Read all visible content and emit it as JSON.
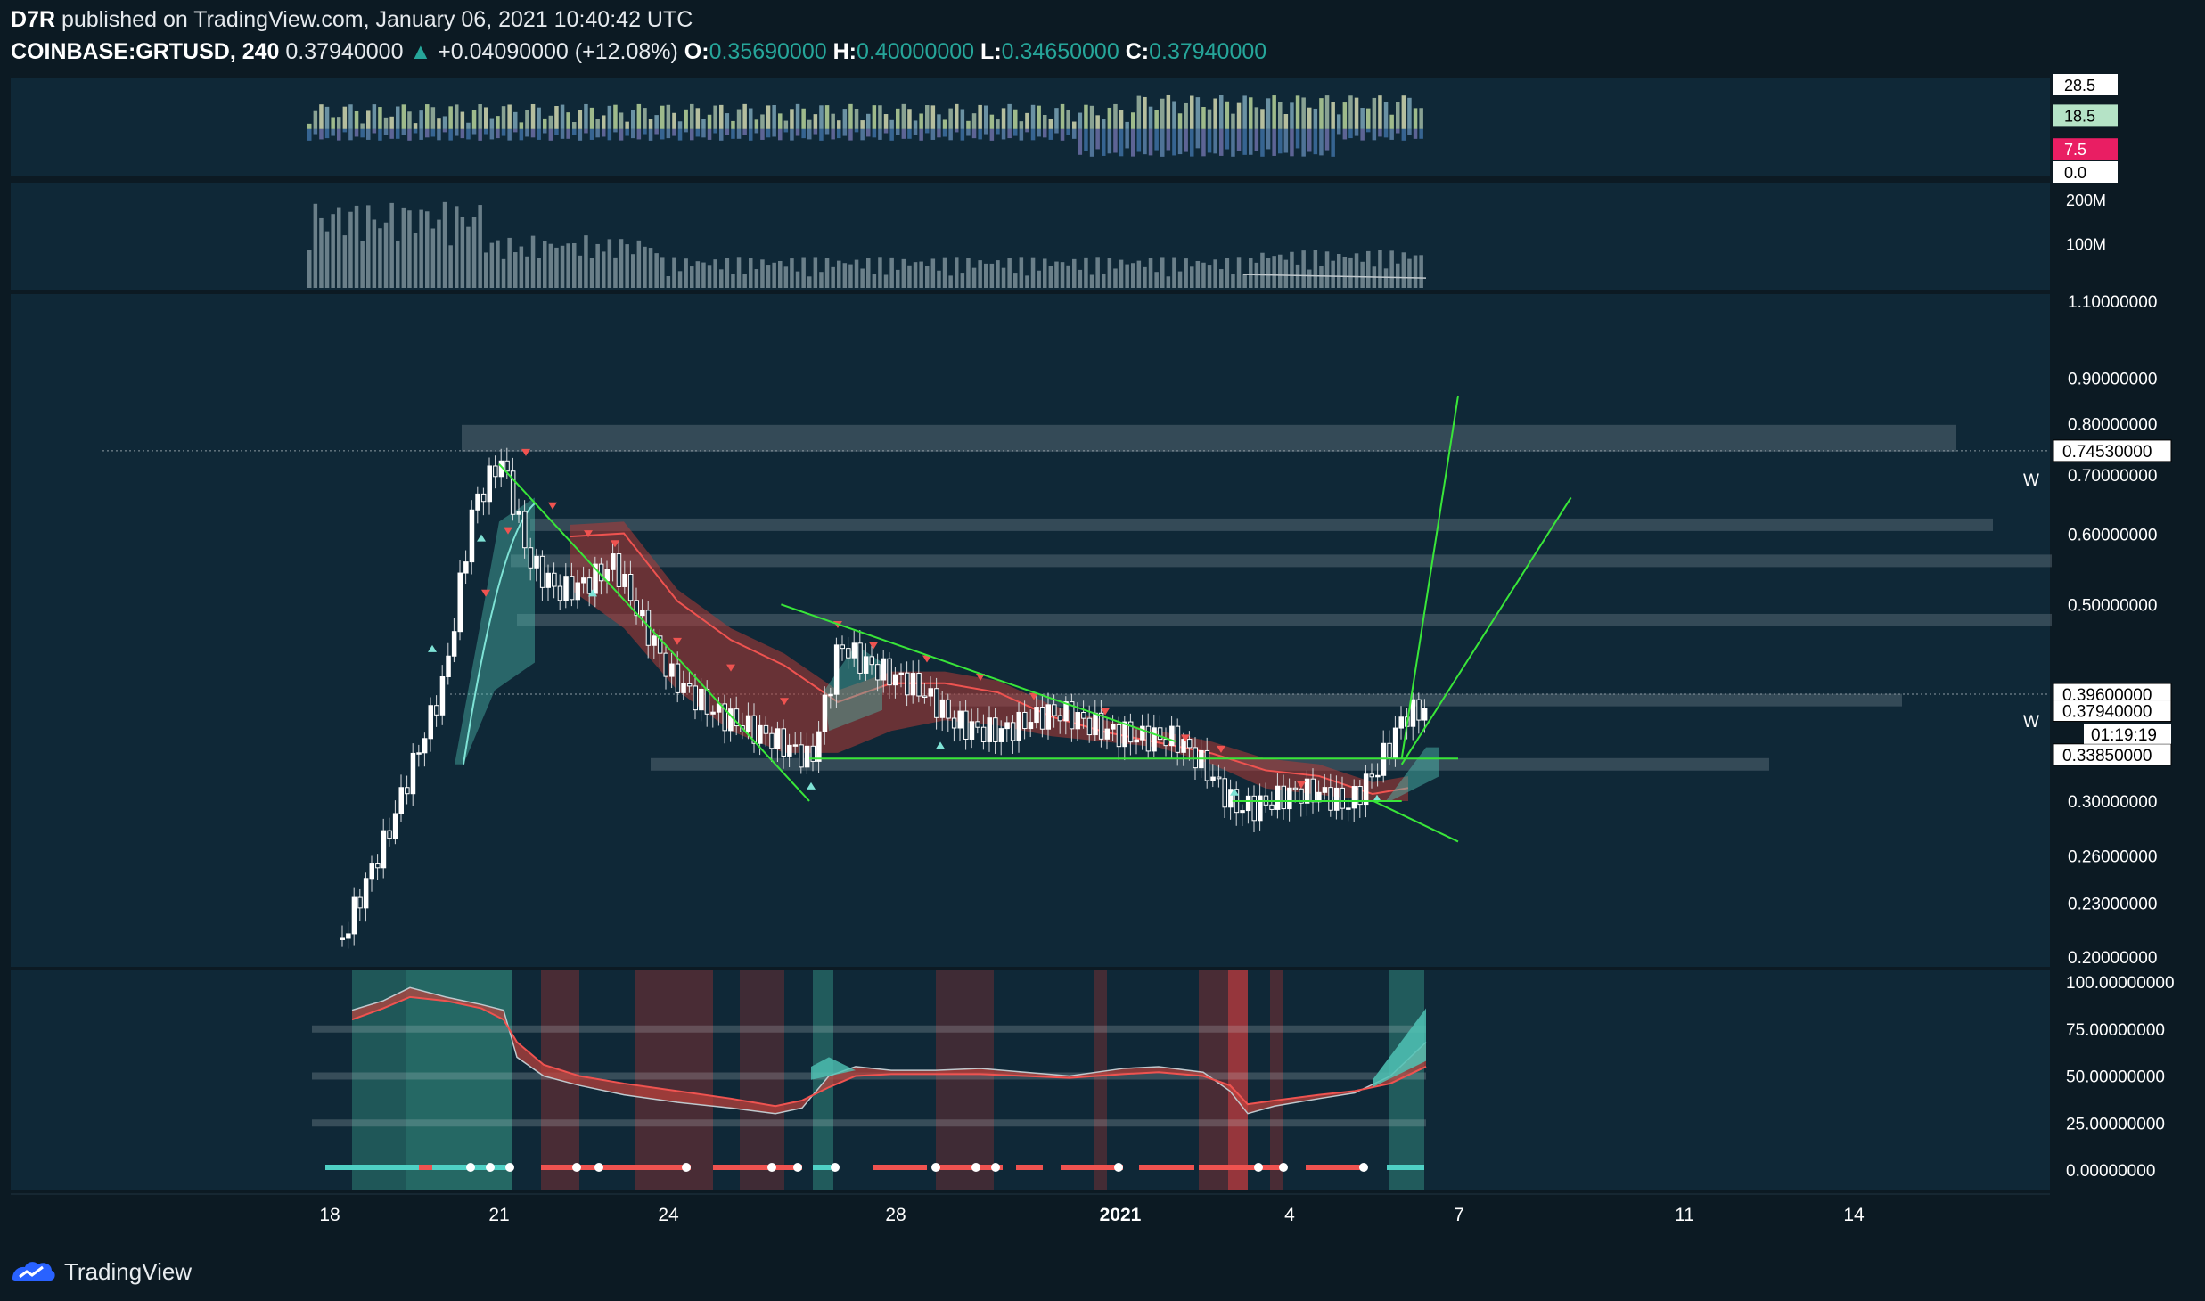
{
  "header": {
    "author": "D7R",
    "published_text": "published on TradingView.com, January 06, 2021 10:40:42 UTC",
    "symbol": "COINBASE:GRTUSD, 240",
    "last": "0.37940000",
    "change": "+0.04090000 (+12.08%)",
    "o_label": "O:",
    "o_value": "0.35690000",
    "h_label": "H:",
    "h_value": "0.40000000",
    "l_label": "L:",
    "l_value": "0.34650000",
    "c_label": "C:",
    "c_value": "0.37940000"
  },
  "footer": {
    "brand": "TradingView",
    "icon": "tradingview-logo-icon"
  },
  "colors": {
    "background": "#0c1a23",
    "pane": "#0f2837",
    "bull": "#26a69a",
    "bear": "#ef5350",
    "trendline": "#39e639",
    "zone": "#7b8a94",
    "teal_fill": "#4fc3b5",
    "red_fill": "#b33a36"
  },
  "chart_data": [
    {
      "type": "bar",
      "pane": "oscillator-top",
      "axis_ticks": [
        "28.5",
        "18.5",
        "7.5",
        "0.0"
      ],
      "highlighted_ticks": {
        "18.5": "#b5e3c6",
        "7.5": "#e91e63"
      }
    },
    {
      "type": "bar",
      "pane": "volume",
      "axis_ticks": [
        "200M",
        "100M"
      ]
    },
    {
      "type": "line",
      "pane": "price",
      "symbol": "COINBASE:GRTUSD",
      "interval": "240",
      "x_ticks": [
        "18",
        "21",
        "24",
        "28",
        "2021",
        "4",
        "7",
        "11",
        "14"
      ],
      "y_ticks": [
        "1.10000000",
        "0.90000000",
        "0.80000000",
        "0.70000000",
        "0.60000000",
        "0.50000000",
        "0.30000000",
        "0.26000000",
        "0.23000000",
        "0.20000000"
      ],
      "y_scale": "log",
      "ylim": [
        0.195,
        1.12
      ],
      "price_labels": [
        {
          "value": "0.74530000",
          "style": "white"
        },
        {
          "value": "0.39600000",
          "style": "white"
        },
        {
          "value": "0.37940000",
          "style": "white"
        },
        {
          "value": "0.33850000",
          "style": "white"
        }
      ],
      "countdown": "01:19:19",
      "w_markers": [
        "W",
        "W"
      ],
      "close_series": [
        {
          "date": "Dec 18",
          "close": 0.2
        },
        {
          "date": "Dec 19",
          "close": 0.27
        },
        {
          "date": "Dec 20",
          "close": 0.42
        },
        {
          "date": "Dec 20 12:00",
          "close": 0.65
        },
        {
          "date": "Dec 21",
          "close": 0.72
        },
        {
          "date": "Dec 21 12:00",
          "close": 0.55
        },
        {
          "date": "Dec 22",
          "close": 0.52
        },
        {
          "date": "Dec 23",
          "close": 0.56
        },
        {
          "date": "Dec 23 12:00",
          "close": 0.47
        },
        {
          "date": "Dec 24",
          "close": 0.41
        },
        {
          "date": "Dec 25",
          "close": 0.38
        },
        {
          "date": "Dec 26",
          "close": 0.34
        },
        {
          "date": "Dec 26 12:00",
          "close": 0.33
        },
        {
          "date": "Dec 27",
          "close": 0.46
        },
        {
          "date": "Dec 28",
          "close": 0.41
        },
        {
          "date": "Dec 29",
          "close": 0.37
        },
        {
          "date": "Dec 30",
          "close": 0.365
        },
        {
          "date": "Dec 31",
          "close": 0.37
        },
        {
          "date": "Jan 1",
          "close": 0.365
        },
        {
          "date": "Jan 2",
          "close": 0.345
        },
        {
          "date": "Jan 3",
          "close": 0.3
        },
        {
          "date": "Jan 4",
          "close": 0.305
        },
        {
          "date": "Jan 5",
          "close": 0.295
        },
        {
          "date": "Jan 5 12:00",
          "close": 0.33
        },
        {
          "date": "Jan 6",
          "close": 0.3794
        }
      ],
      "resistance_zones": [
        0.77,
        0.615,
        0.56,
        0.48,
        0.39,
        0.33
      ],
      "trendlines": [
        {
          "from": [
            "Dec 21",
            0.72
          ],
          "to": [
            "Dec 26 12:00",
            0.3
          ]
        },
        {
          "from": [
            "Dec 26",
            0.5
          ],
          "to": [
            "Jan 2",
            0.35
          ]
        },
        {
          "from": [
            "Dec 26 12:00",
            0.335
          ],
          "to": [
            "Jan 7",
            0.335
          ]
        },
        {
          "from": [
            "Jan 3",
            0.3
          ],
          "to": [
            "Jan 6",
            0.3
          ]
        },
        {
          "from": [
            "Jan 5 12:00",
            0.3
          ],
          "to": [
            "Jan 7",
            0.27
          ]
        },
        {
          "from": [
            "Jan 6",
            0.335
          ],
          "to": [
            "Jan 7",
            0.86
          ]
        },
        {
          "from": [
            "Jan 6",
            0.33
          ],
          "to": [
            "Jan 9",
            0.66
          ]
        }
      ]
    },
    {
      "type": "line",
      "pane": "stoch-rsi",
      "y_ticks": [
        "100.00000000",
        "75.00000000",
        "50.00000000",
        "25.00000000",
        "0.00000000"
      ],
      "ylim": [
        0,
        100
      ],
      "levels": [
        75,
        50,
        25
      ]
    }
  ]
}
